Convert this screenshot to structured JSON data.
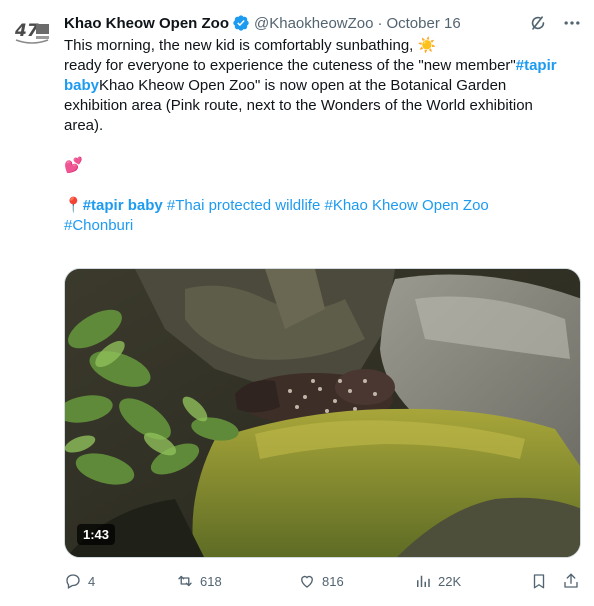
{
  "tweet": {
    "author_name": "Khao Kheow Open Zoo",
    "handle": "@KhaokheowZoo",
    "separator": "·",
    "date": "October 16",
    "text_line1": "This morning, the new kid is comfortably sunbathing,",
    "sun_emoji": "☀️",
    "text_line2": "ready for everyone to experience the cuteness of the \"new member\"",
    "tag_inline_a": "#tapir",
    "tag_inline_b": "baby",
    "text_line3_rest": "Khao Kheow Open Zoo\" is now open at the Botanical Garden",
    "text_line4": "exhibition area (Pink route, next to the Wonders of the World exhibition",
    "text_line5": "area).",
    "heart_emoji": "💕",
    "pin_emoji": "📍",
    "tag1": "#tapir baby",
    "tag2": "#Thai protected wildlife",
    "tag3": "#Khao Kheow Open Zoo",
    "tag4": "#Chonburi",
    "video_duration": "1:43"
  },
  "actions": {
    "replies": "4",
    "reposts": "618",
    "likes": "816",
    "views": "22K"
  },
  "icons": {
    "verified": "verified-badge-icon",
    "grok": "grok-icon",
    "more": "more-icon",
    "reply": "reply-icon",
    "repost": "repost-icon",
    "like": "like-icon",
    "views": "views-icon",
    "bookmark": "bookmark-icon",
    "share": "share-icon"
  },
  "colors": {
    "link": "#1d9bf0",
    "secondary": "#536471",
    "verified": "#1d9bf0"
  }
}
